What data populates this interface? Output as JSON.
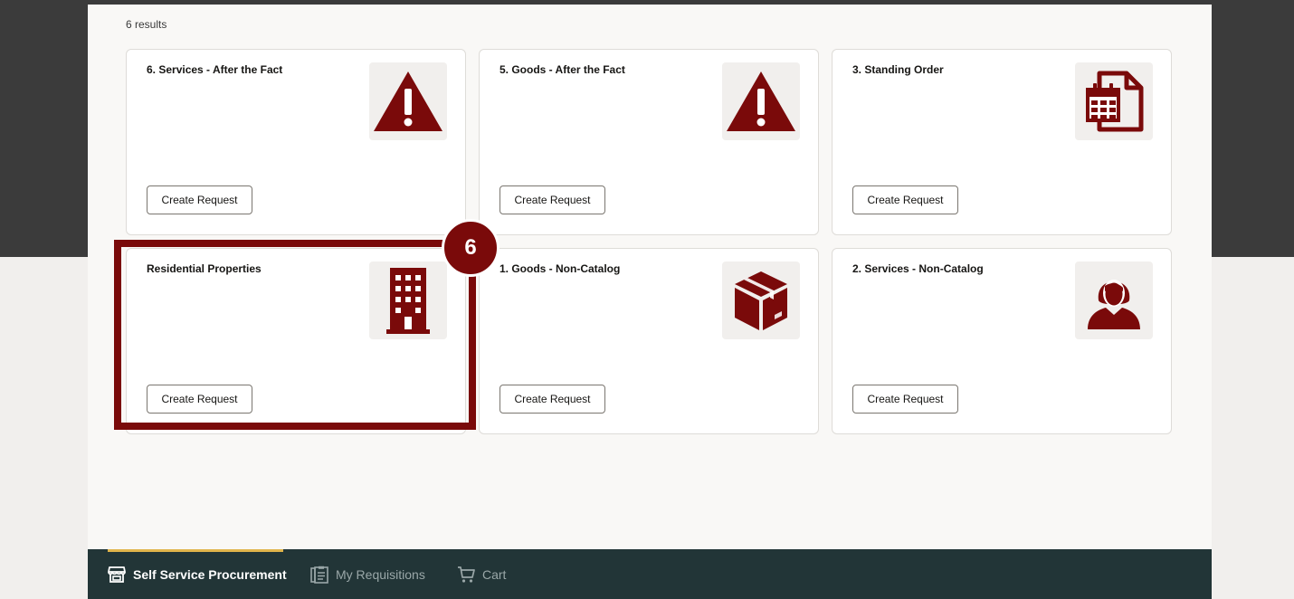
{
  "results": {
    "count_label": "6 results"
  },
  "cards": [
    {
      "title": "6. Services - After the Fact",
      "icon": "warning-icon",
      "button": "Create Request"
    },
    {
      "title": "5. Goods - After the Fact",
      "icon": "warning-icon",
      "button": "Create Request"
    },
    {
      "title": "3. Standing Order",
      "icon": "calendar-document-icon",
      "button": "Create Request"
    },
    {
      "title": "Residential Properties",
      "icon": "building-icon",
      "button": "Create Request"
    },
    {
      "title": "1. Goods - Non-Catalog",
      "icon": "package-icon",
      "button": "Create Request"
    },
    {
      "title": "2. Services - Non-Catalog",
      "icon": "person-icon",
      "button": "Create Request"
    }
  ],
  "callout": {
    "step": "6"
  },
  "nav": {
    "items": [
      {
        "label": "Self Service Procurement",
        "icon": "store-icon",
        "active": true
      },
      {
        "label": "My Requisitions",
        "icon": "clipboard-icon",
        "active": false
      },
      {
        "label": "Cart",
        "icon": "cart-icon",
        "active": false
      }
    ]
  },
  "colors": {
    "icon_accent": "#7a0a0a",
    "nav_background": "#223537",
    "nav_active_indicator": "#e0b44b"
  }
}
